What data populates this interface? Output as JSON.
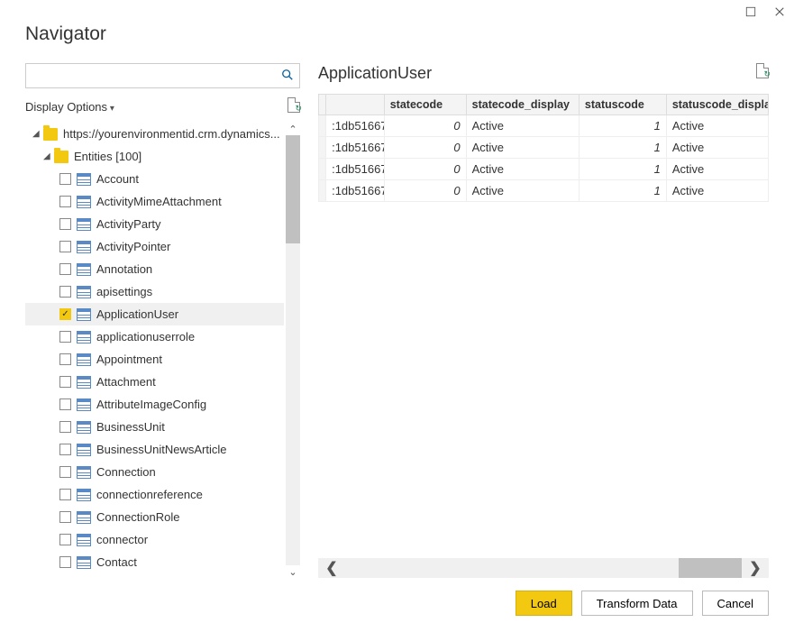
{
  "window": {
    "title": "Navigator"
  },
  "left": {
    "search_placeholder": "",
    "display_options_label": "Display Options",
    "root_label": "https://yourenvironmentid.crm.dynamics...",
    "group_label": "Entities [100]",
    "entities": [
      {
        "label": "Account",
        "checked": false,
        "selected": false
      },
      {
        "label": "ActivityMimeAttachment",
        "checked": false,
        "selected": false
      },
      {
        "label": "ActivityParty",
        "checked": false,
        "selected": false
      },
      {
        "label": "ActivityPointer",
        "checked": false,
        "selected": false
      },
      {
        "label": "Annotation",
        "checked": false,
        "selected": false
      },
      {
        "label": "apisettings",
        "checked": false,
        "selected": false
      },
      {
        "label": "ApplicationUser",
        "checked": true,
        "selected": true
      },
      {
        "label": "applicationuserrole",
        "checked": false,
        "selected": false
      },
      {
        "label": "Appointment",
        "checked": false,
        "selected": false
      },
      {
        "label": "Attachment",
        "checked": false,
        "selected": false
      },
      {
        "label": "AttributeImageConfig",
        "checked": false,
        "selected": false
      },
      {
        "label": "BusinessUnit",
        "checked": false,
        "selected": false
      },
      {
        "label": "BusinessUnitNewsArticle",
        "checked": false,
        "selected": false
      },
      {
        "label": "Connection",
        "checked": false,
        "selected": false
      },
      {
        "label": "connectionreference",
        "checked": false,
        "selected": false
      },
      {
        "label": "ConnectionRole",
        "checked": false,
        "selected": false
      },
      {
        "label": "connector",
        "checked": false,
        "selected": false
      },
      {
        "label": "Contact",
        "checked": false,
        "selected": false
      }
    ]
  },
  "preview": {
    "title": "ApplicationUser",
    "columns": [
      "",
      "statecode",
      "statecode_display",
      "statuscode",
      "statuscode_display"
    ],
    "rows": [
      {
        "c0": ":1db51667",
        "c1": "0",
        "c2": "Active",
        "c3": "1",
        "c4": "Active"
      },
      {
        "c0": ":1db51667",
        "c1": "0",
        "c2": "Active",
        "c3": "1",
        "c4": "Active"
      },
      {
        "c0": ":1db51667",
        "c1": "0",
        "c2": "Active",
        "c3": "1",
        "c4": "Active"
      },
      {
        "c0": ":1db51667",
        "c1": "0",
        "c2": "Active",
        "c3": "1",
        "c4": "Active"
      }
    ]
  },
  "footer": {
    "load_label": "Load",
    "transform_label": "Transform Data",
    "cancel_label": "Cancel"
  }
}
